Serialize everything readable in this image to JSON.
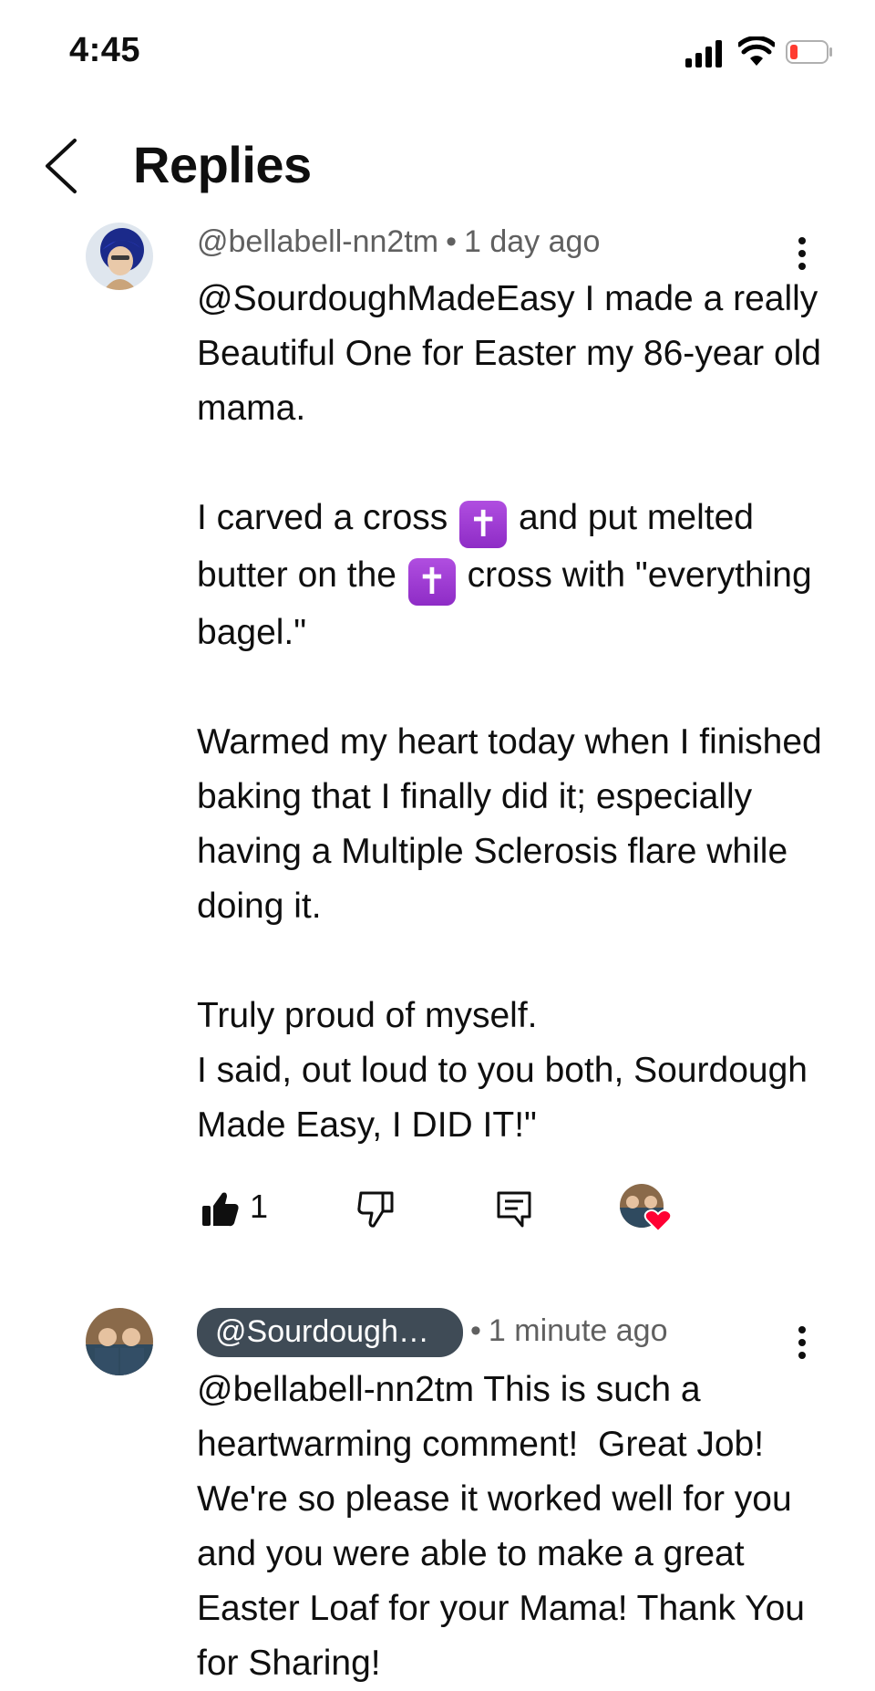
{
  "status_bar": {
    "time": "4:45",
    "battery_color": "#ff3b30"
  },
  "header": {
    "title": "Replies"
  },
  "comments": [
    {
      "author": "@bellabell-nn2tm",
      "separator": "•",
      "time": "1 day ago",
      "body": {
        "p1": "@SourdoughMadeEasy I made a really Beautiful One for Easter my 86-year old mama.",
        "p2_a": "I carved a cross ",
        "emoji": "✝",
        "p2_b": " and put melted butter on the ",
        "p2_c": " cross with \"everything bagel.\"",
        "p3": "Warmed my heart today when I finished baking that I finally did it; especially having a Multiple Sclerosis flare while doing it.",
        "p4": "Truly proud of myself.\nI said, out loud to you both, Sourdough Made Easy, I DID IT!\""
      },
      "likes": "1",
      "icons": [
        "like-icon",
        "dislike-icon",
        "reply-icon",
        "creator-heart-icon"
      ]
    },
    {
      "author": "@SourdoughMad...",
      "separator": "•",
      "time": "1 minute ago",
      "body": "@bellabell-nn2tm This is such a heartwarming comment!  Great Job! We're so please it worked well for you and you were able to make a great Easter Loaf for your Mama! Thank You for Sharing!"
    }
  ]
}
